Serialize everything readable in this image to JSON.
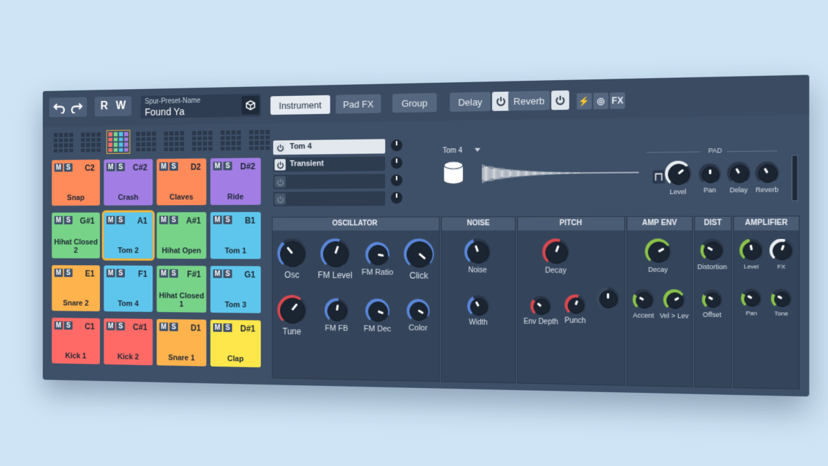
{
  "toolbar": {
    "undo": "undo-icon",
    "redo": "redo-icon",
    "read": "R",
    "write": "W"
  },
  "preset": {
    "label": "Spur-Preset-Name",
    "value": "Found Ya",
    "save_icon": "save-icon"
  },
  "tabs": {
    "instrument": "Instrument",
    "padfx": "Pad FX",
    "group": "Group",
    "delay": "Delay",
    "reverb": "Reverb",
    "fx": "FX"
  },
  "pads": [
    {
      "name": "Snap",
      "note": "C2",
      "color": "#ff8a5a"
    },
    {
      "name": "Crash",
      "note": "C#2",
      "color": "#a27de3"
    },
    {
      "name": "Claves",
      "note": "D2",
      "color": "#ff8a5a"
    },
    {
      "name": "Ride",
      "note": "D#2",
      "color": "#a27de3"
    },
    {
      "name": "Hihat Closed 2",
      "note": "G#1",
      "color": "#77d388"
    },
    {
      "name": "Tom 2",
      "note": "A1",
      "color": "#5ec6ec"
    },
    {
      "name": "Hihat Open",
      "note": "A#1",
      "color": "#77d388"
    },
    {
      "name": "Tom 1",
      "note": "B1",
      "color": "#5ec6ec"
    },
    {
      "name": "Snare 2",
      "note": "E1",
      "color": "#ffb34d"
    },
    {
      "name": "Tom 4",
      "note": "F1",
      "color": "#5ec6ec"
    },
    {
      "name": "Hihat Closed 1",
      "note": "F#1",
      "color": "#77d388"
    },
    {
      "name": "Tom 3",
      "note": "G1",
      "color": "#5ec6ec"
    },
    {
      "name": "Kick 1",
      "note": "C1",
      "color": "#ff6a66"
    },
    {
      "name": "Kick 2",
      "note": "C#1",
      "color": "#ff6a66"
    },
    {
      "name": "Snare 1",
      "note": "D1",
      "color": "#ffb34d"
    },
    {
      "name": "Clap",
      "note": "D#1",
      "color": "#fde74a"
    }
  ],
  "pad_ms": {
    "mute": "M",
    "solo": "S"
  },
  "layers": [
    {
      "name": "Tom 4"
    },
    {
      "name": "Transient"
    },
    {
      "name": ""
    },
    {
      "name": ""
    }
  ],
  "instrument": {
    "name": "Tom 4"
  },
  "pad_section": {
    "title": "PAD",
    "knobs": [
      "Level",
      "Pan",
      "Delay",
      "Reverb"
    ]
  },
  "modules": {
    "oscillator": {
      "title": "OSCILLATOR",
      "knobs": [
        "Osc",
        "FM Level",
        "FM Ratio",
        "Click",
        "Tune",
        "FM FB",
        "FM Dec",
        "Color"
      ]
    },
    "noise": {
      "title": "NOISE",
      "knobs": [
        "Noise",
        "Width"
      ]
    },
    "pitch": {
      "title": "PITCH",
      "knobs": [
        "Decay",
        "Env Depth",
        "Punch"
      ]
    },
    "ampenv": {
      "title": "AMP ENV",
      "knobs": [
        "Decay",
        "Accent",
        "Vel > Lev"
      ]
    },
    "dist": {
      "title": "DIST",
      "knobs": [
        "Distortion",
        "Offset"
      ]
    },
    "amplifier": {
      "title": "AMPLIFIER",
      "knobs": [
        "Level",
        "FX",
        "Pan",
        "Tone"
      ]
    }
  },
  "colors": {
    "blue": "#5a86d8",
    "red": "#d9474f",
    "green": "#8bc34a",
    "white": "#e8edf2"
  }
}
